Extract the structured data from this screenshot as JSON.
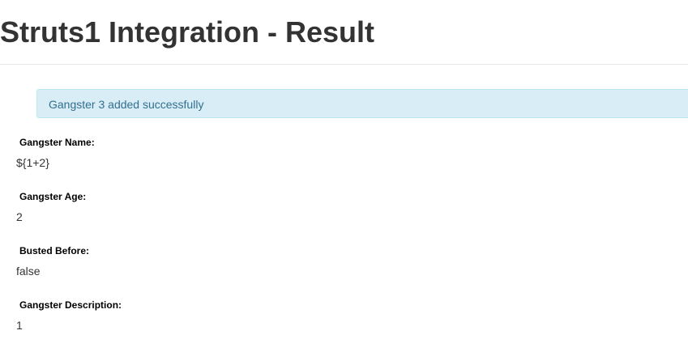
{
  "header": {
    "title": "Struts1 Integration - Result"
  },
  "alert": {
    "message": "Gangster 3 added successfully"
  },
  "fields": {
    "name": {
      "label": "Gangster Name:",
      "value": "${1+2}"
    },
    "age": {
      "label": "Gangster Age:",
      "value": "2"
    },
    "busted": {
      "label": "Busted Before:",
      "value": "false"
    },
    "description": {
      "label": "Gangster Description:",
      "value": "1"
    }
  },
  "colors": {
    "alert_background": "#d9edf7",
    "alert_border": "#bce8f1",
    "alert_text": "#31708f",
    "title_text": "#333333"
  }
}
